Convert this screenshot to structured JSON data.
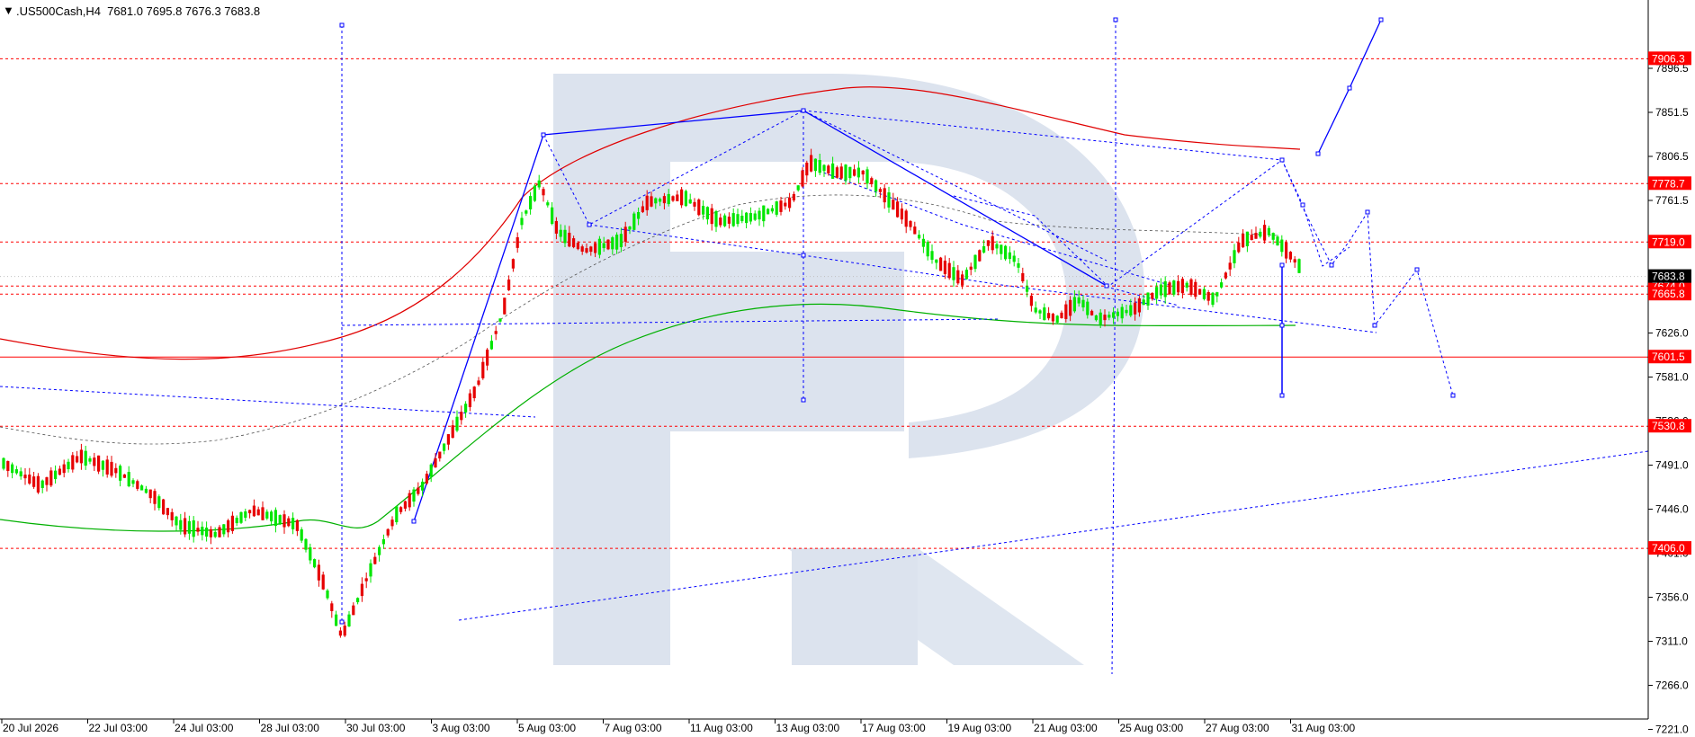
{
  "chart_data": {
    "type": "candlestick",
    "title": ".US500Cash,H4  7681.0 7695.8 7676.3 7683.8",
    "symbol": ".US500Cash",
    "timeframe": "H4",
    "ohlc_header": {
      "open": 7681.0,
      "high": 7695.8,
      "low": 7676.3,
      "close": 7683.8
    },
    "y_ticks": [
      "7896.5",
      "7851.5",
      "7806.5",
      "7761.5",
      "7671.0",
      "7626.0",
      "7581.0",
      "7536.0",
      "7491.0",
      "7446.0",
      "7401.0",
      "7356.0",
      "7311.0",
      "7266.0",
      "7221.0"
    ],
    "x_ticks": [
      "20 Jul 2026",
      "22 Jul 03:00",
      "24 Jul 03:00",
      "28 Jul 03:00",
      "30 Jul 03:00",
      "3 Aug 03:00",
      "5 Aug 03:00",
      "7 Aug 03:00",
      "11 Aug 03:00",
      "13 Aug 03:00",
      "17 Aug 03:00",
      "19 Aug 03:00",
      "21 Aug 03:00",
      "25 Aug 03:00",
      "27 Aug 03:00",
      "31 Aug 03:00"
    ],
    "levels": [
      {
        "value": 7906.3,
        "label": "7906.3"
      },
      {
        "value": 7778.7,
        "label": "7778.7"
      },
      {
        "value": 7719.0,
        "label": "7719.0"
      },
      {
        "value": 7674.0,
        "label": "7674.0"
      },
      {
        "value": 7665.8,
        "label": "7665.8"
      },
      {
        "value": 7601.5,
        "label": "7601.5"
      },
      {
        "value": 7530.8,
        "label": "7530.8"
      },
      {
        "value": 7406.0,
        "label": "7406.0"
      }
    ],
    "current_price": {
      "value": 7683.8,
      "label": "7683.8"
    },
    "legend": "none",
    "grid": false,
    "colors": {
      "bull": "#00e600",
      "bear": "#e60000",
      "level": "#ff0000",
      "pattern": "#0000ff",
      "ma_slow": "#e00000",
      "ma_fast": "#00b000",
      "watermark": "#dce3ee",
      "current": "#000000"
    }
  }
}
